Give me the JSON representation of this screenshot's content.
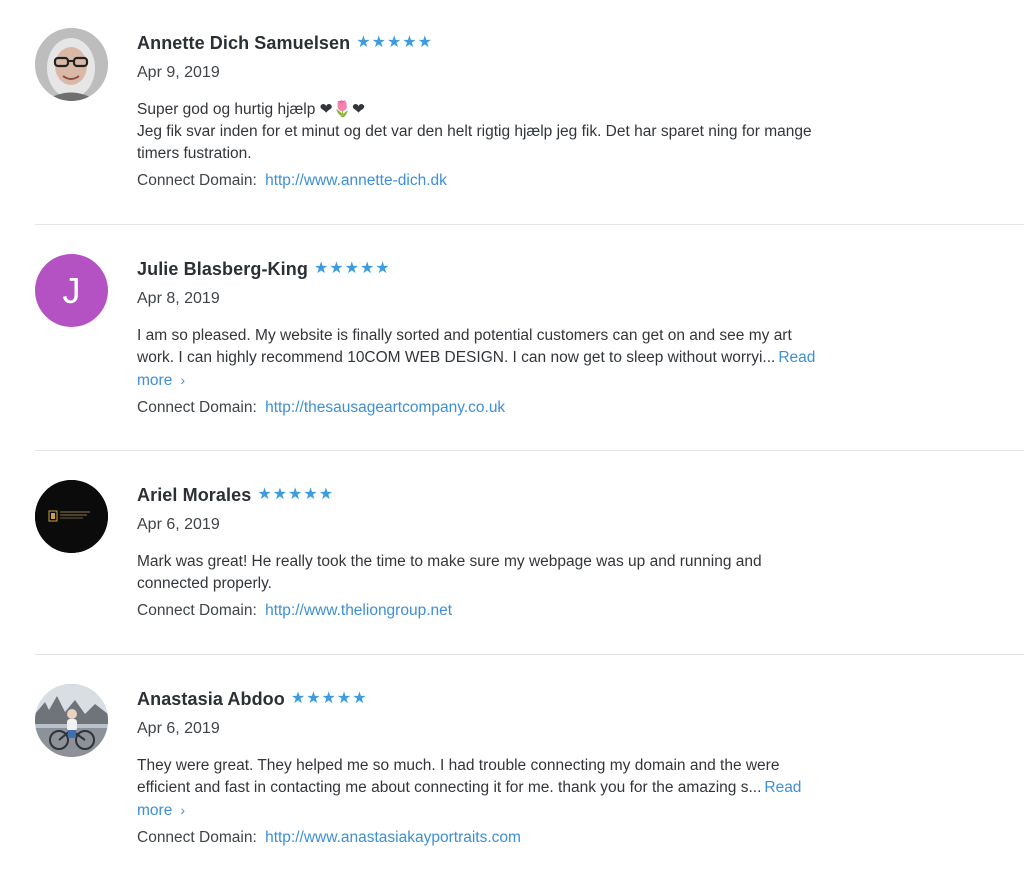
{
  "colors": {
    "star": "#3d9ce0",
    "link": "#3d8fd6",
    "avatar_julie_bg": "#b452c4",
    "avatar_ariel_bg": "#0b0b0b"
  },
  "star_icon": "star-icon",
  "read_more_label": "Read more",
  "reviews": [
    {
      "name": "Annette Dich Samuelsen",
      "rating": 5,
      "date": "Apr 9, 2019",
      "text": "Super god og hurtig hjælp ❤🌷❤\nJeg fik svar inden for et minut og det var den helt rigtig hjælp jeg fik. Det har sparet ning for mange timers fustration.",
      "domain_label": "Connect Domain:",
      "domain_url": "http://www.annette-dich.dk"
    },
    {
      "name": "Julie Blasberg-King",
      "rating": 5,
      "date": "Apr 8, 2019",
      "avatar_letter": "J",
      "text": "I am so pleased. My website is finally sorted and potential customers can get on and see my art work. I can highly recommend 10COM WEB DESIGN. I can now get to sleep without worryi...",
      "domain_label": "Connect Domain:",
      "domain_url": "http://thesausageartcompany.co.uk"
    },
    {
      "name": "Ariel Morales",
      "rating": 5,
      "date": "Apr 6, 2019",
      "text": "Mark was great! He really took the time to make sure my webpage was up and running and connected properly.",
      "domain_label": "Connect Domain:",
      "domain_url": "http://www.theliongroup.net"
    },
    {
      "name": "Anastasia Abdoo",
      "rating": 5,
      "date": "Apr 6, 2019",
      "text": "They were great. They helped me so much. I had trouble connecting my domain and the were efficient and fast in contacting me about connecting it for me. thank you for the amazing s...",
      "domain_label": "Connect Domain:",
      "domain_url": "http://www.anastasiakayportraits.com"
    }
  ]
}
